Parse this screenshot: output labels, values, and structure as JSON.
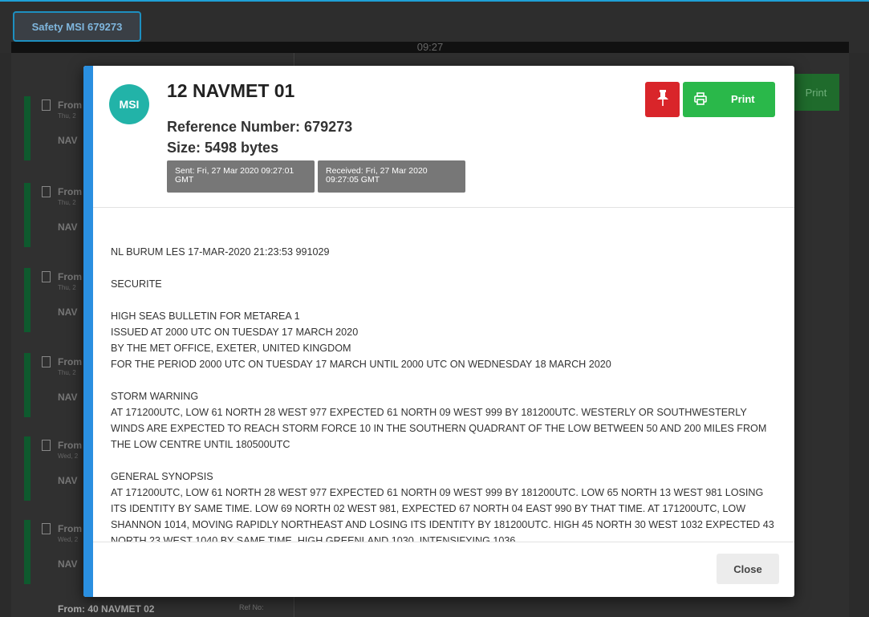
{
  "background": {
    "tab_label": "Safety MSI 679273",
    "strip_time": "09:27",
    "list_items": [
      {
        "from": "From",
        "day": "Thu, 2",
        "nav": "NAV"
      },
      {
        "from": "From",
        "day": "Thu, 2",
        "nav": "NAV"
      },
      {
        "from": "From",
        "day": "Thu, 2",
        "nav": "NAV"
      },
      {
        "from": "From",
        "day": "Thu, 2",
        "nav": "NAV"
      },
      {
        "from": "From",
        "day": "Wed, 2",
        "nav": "NAV"
      },
      {
        "from": "From",
        "day": "Wed, 2",
        "nav": "NAV"
      }
    ],
    "last_item_from": "From: 40 NAVMET 02",
    "last_item_ref": "Ref No:",
    "print_label": "Print"
  },
  "modal": {
    "avatar_text": "MSI",
    "title": "12 NAVMET 01",
    "reference": "Reference Number: 679273",
    "size": "Size: 5498 bytes",
    "sent": "Sent: Fri, 27 Mar 2020 09:27:01 GMT",
    "received": "Received: Fri, 27 Mar 2020 09:27:05 GMT",
    "pin_icon": "pin-icon",
    "print_icon": "printer-icon",
    "print_label": "Print",
    "close_label": "Close",
    "colors": {
      "accent": "#2a8fe0",
      "pin": "#d9252a",
      "print": "#2ab84a",
      "avatar": "#22b3a8"
    },
    "body": [
      "NL BURUM LES 17-MAR-2020 21:23:53 991029",
      "SECURITE",
      "HIGH SEAS BULLETIN FOR METAREA 1\nISSUED AT 2000 UTC ON TUESDAY 17 MARCH 2020\nBY THE MET OFFICE, EXETER, UNITED KINGDOM\nFOR THE PERIOD 2000 UTC ON TUESDAY 17 MARCH UNTIL 2000 UTC ON WEDNESDAY 18 MARCH 2020",
      "STORM WARNING\nAT 171200UTC, LOW 61 NORTH 28 WEST 977 EXPECTED 61 NORTH 09 WEST 999 BY 181200UTC. WESTERLY OR SOUTHWESTERLY WINDS ARE EXPECTED TO REACH STORM FORCE 10 IN THE SOUTHERN QUADRANT OF THE LOW BETWEEN 50 AND 200 MILES FROM THE LOW CENTRE UNTIL 180500UTC",
      "GENERAL SYNOPSIS\nAT 171200UTC, LOW 61 NORTH 28 WEST 977 EXPECTED 61 NORTH 09 WEST 999 BY 181200UTC. LOW 65 NORTH 13 WEST 981 LOSING ITS IDENTITY BY SAME TIME. LOW 69 NORTH 02 WEST 981, EXPECTED 67 NORTH 04 EAST 990 BY THAT TIME. AT 171200UTC, LOW SHANNON 1014, MOVING RAPIDLY NORTHEAST AND LOSING ITS IDENTITY BY 181200UTC. HIGH 45 NORTH 30 WEST 1032 EXPECTED 43 NORTH 23 WEST 1040 BY SAME TIME. HIGH GREENLAND 1030, INTENSIFYING 1036"
    ]
  }
}
